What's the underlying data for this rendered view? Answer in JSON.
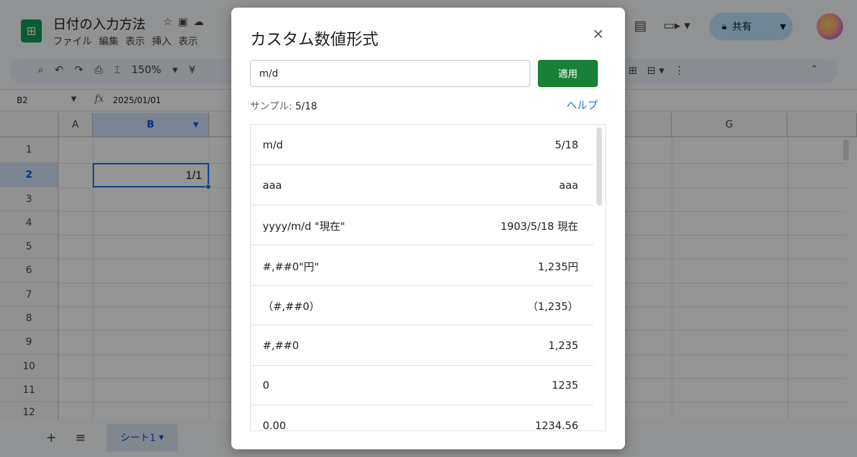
{
  "doc": {
    "title": "日付の入力方法",
    "menus": [
      "ファイル",
      "編集",
      "表示",
      "挿入",
      "表示"
    ]
  },
  "header": {
    "share_label": "共有"
  },
  "toolbar": {
    "zoom": "150%",
    "currency_symbol": "¥"
  },
  "formula_bar": {
    "cell_ref": "B2",
    "value": "2025/01/01"
  },
  "grid": {
    "columns": [
      "A",
      "B",
      "G"
    ],
    "rows": [
      "1",
      "2",
      "3",
      "4",
      "5",
      "6",
      "7",
      "8",
      "9",
      "10",
      "11",
      "12"
    ],
    "active_cell_display": "1/1"
  },
  "sheets": {
    "tabs": [
      "シート1"
    ]
  },
  "dialog": {
    "title": "カスタム数値形式",
    "input_value": "m/d",
    "apply_label": "適用",
    "sample_label": "サンプル:",
    "sample_value": "5/18",
    "help_label": "ヘルプ",
    "formats": [
      {
        "pattern": "m/d",
        "preview": "5/18"
      },
      {
        "pattern": "aaa",
        "preview": "aaa"
      },
      {
        "pattern": "yyyy/m/d \"現在\"",
        "preview": "1903/5/18 現在"
      },
      {
        "pattern": "#,##0\"円\"",
        "preview": "1,235円"
      },
      {
        "pattern": "（#,##0）",
        "preview": "（1,235）"
      },
      {
        "pattern": "#,##0",
        "preview": "1,235"
      },
      {
        "pattern": "0",
        "preview": "1235"
      },
      {
        "pattern": "0.00",
        "preview": "1234.56"
      }
    ]
  },
  "colors": {
    "accent_green": "#188038",
    "link_blue": "#1a73e8",
    "selection_blue": "#d3e3fd"
  }
}
